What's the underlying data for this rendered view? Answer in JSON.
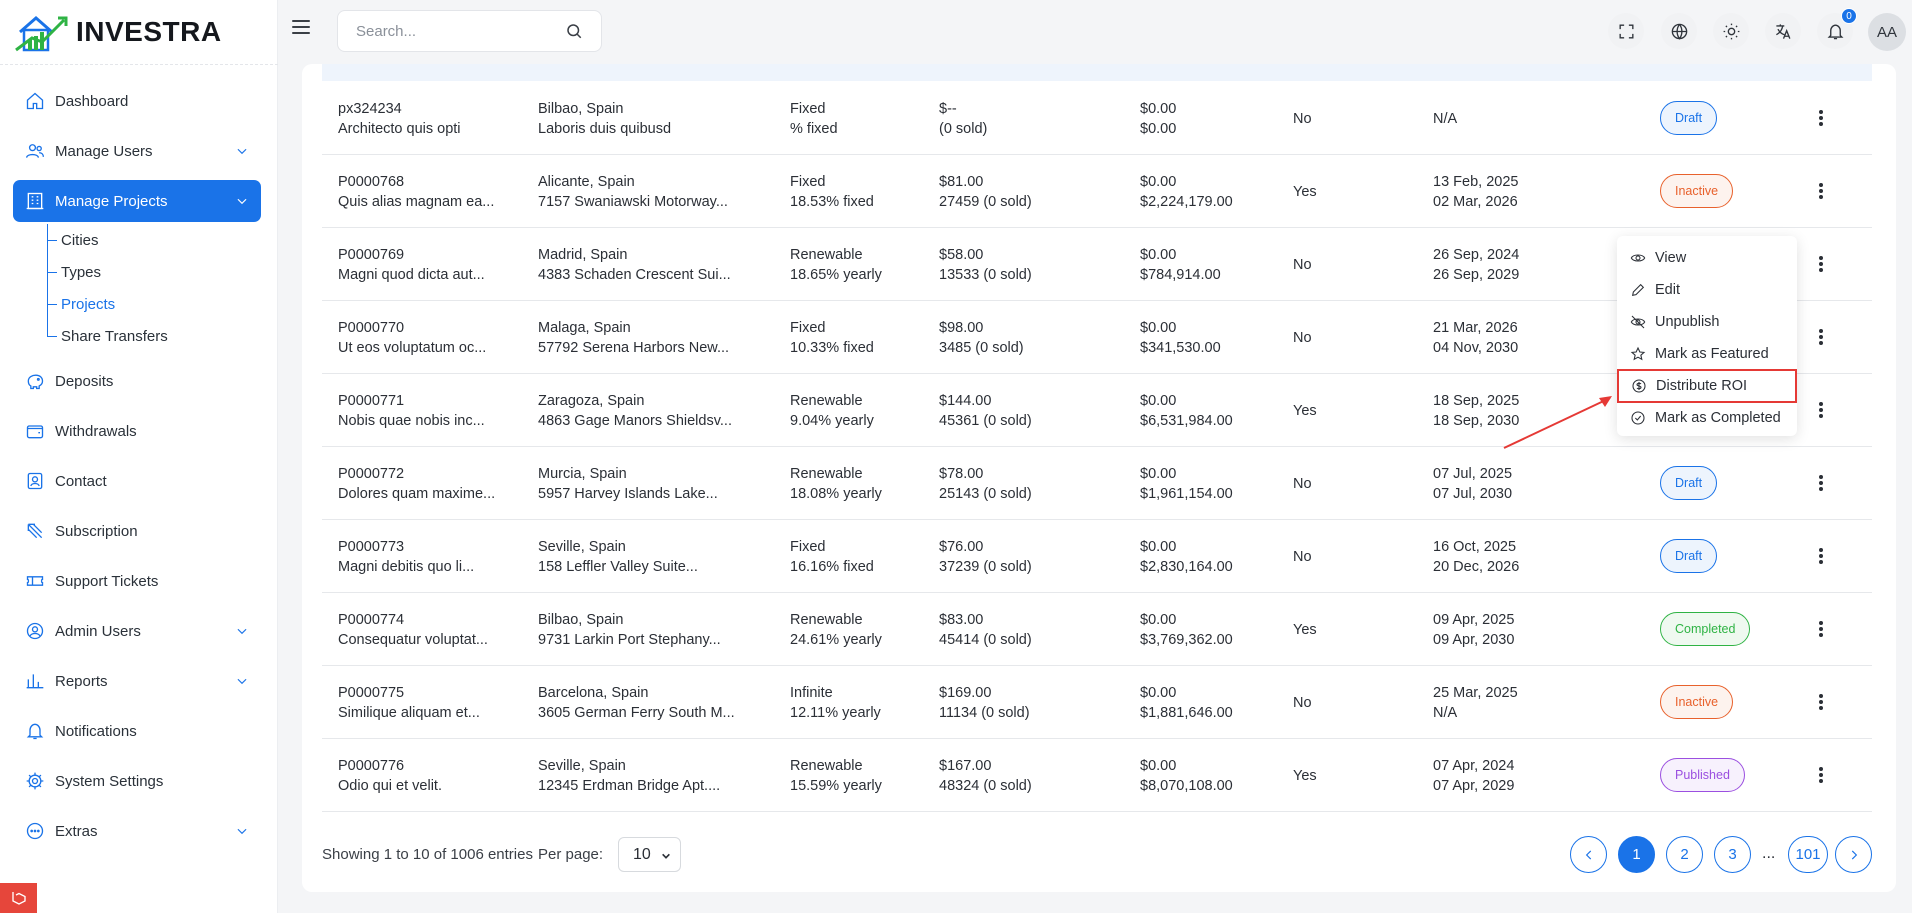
{
  "brand": {
    "name": "INVESTRA"
  },
  "header": {
    "search_placeholder": "Search...",
    "notification_count": "0",
    "avatar_initials": "AA"
  },
  "sidebar": {
    "items": [
      {
        "label": "Dashboard",
        "icon": "home-icon"
      },
      {
        "label": "Manage Users",
        "icon": "users-icon",
        "expandable": true
      },
      {
        "label": "Manage Projects",
        "icon": "building-icon",
        "expandable": true,
        "active": true
      },
      {
        "label": "Deposits",
        "icon": "piggy-bank-icon"
      },
      {
        "label": "Withdrawals",
        "icon": "wallet-icon"
      },
      {
        "label": "Contact",
        "icon": "contact-icon"
      },
      {
        "label": "Subscription",
        "icon": "subscription-icon"
      },
      {
        "label": "Support Tickets",
        "icon": "ticket-icon"
      },
      {
        "label": "Admin Users",
        "icon": "admin-icon",
        "expandable": true
      },
      {
        "label": "Reports",
        "icon": "chart-icon",
        "expandable": true
      },
      {
        "label": "Notifications",
        "icon": "bell-icon"
      },
      {
        "label": "System Settings",
        "icon": "gear-icon"
      },
      {
        "label": "Extras",
        "icon": "extras-icon",
        "expandable": true
      }
    ],
    "subitems": [
      {
        "label": "Cities"
      },
      {
        "label": "Types"
      },
      {
        "label": "Projects",
        "active": true
      },
      {
        "label": "Share Transfers"
      }
    ]
  },
  "rows": [
    {
      "id": "px324234",
      "name": "Architecto quis opti",
      "city": "Bilbao, Spain",
      "address": "Laboris duis quibusd",
      "type": "Fixed",
      "rate": "% fixed",
      "price": "$--",
      "shares": "(0 sold)",
      "invested": "$0.00",
      "target": "$0.00",
      "featured": "No",
      "date1": "N/A",
      "date2": "",
      "status": "Draft"
    },
    {
      "id": "P0000768",
      "name": "Quis alias magnam ea...",
      "city": "Alicante, Spain",
      "address": "7157 Swaniawski Motorway...",
      "type": "Fixed",
      "rate": "18.53% fixed",
      "price": "$81.00",
      "shares": "27459 (0 sold)",
      "invested": "$0.00",
      "target": "$2,224,179.00",
      "featured": "Yes",
      "date1": "13 Feb, 2025",
      "date2": "02 Mar, 2026",
      "status": "Inactive"
    },
    {
      "id": "P0000769",
      "name": "Magni quod dicta aut...",
      "city": "Madrid, Spain",
      "address": "4383 Schaden Crescent Sui...",
      "type": "Renewable",
      "rate": "18.65% yearly",
      "price": "$58.00",
      "shares": "13533 (0 sold)",
      "invested": "$0.00",
      "target": "$784,914.00",
      "featured": "No",
      "date1": "26 Sep, 2024",
      "date2": "26 Sep, 2029",
      "status": ""
    },
    {
      "id": "P0000770",
      "name": "Ut eos voluptatum oc...",
      "city": "Malaga, Spain",
      "address": "57792 Serena Harbors New...",
      "type": "Fixed",
      "rate": "10.33% fixed",
      "price": "$98.00",
      "shares": "3485 (0 sold)",
      "invested": "$0.00",
      "target": "$341,530.00",
      "featured": "No",
      "date1": "21 Mar, 2026",
      "date2": "04 Nov, 2030",
      "status": ""
    },
    {
      "id": "P0000771",
      "name": "Nobis quae nobis inc...",
      "city": "Zaragoza, Spain",
      "address": "4863 Gage Manors Shieldsv...",
      "type": "Renewable",
      "rate": "9.04% yearly",
      "price": "$144.00",
      "shares": "45361 (0 sold)",
      "invested": "$0.00",
      "target": "$6,531,984.00",
      "featured": "Yes",
      "date1": "18 Sep, 2025",
      "date2": "18 Sep, 2030",
      "status": ""
    },
    {
      "id": "P0000772",
      "name": "Dolores quam maxime...",
      "city": "Murcia, Spain",
      "address": "5957 Harvey Islands Lake...",
      "type": "Renewable",
      "rate": "18.08% yearly",
      "price": "$78.00",
      "shares": "25143 (0 sold)",
      "invested": "$0.00",
      "target": "$1,961,154.00",
      "featured": "No",
      "date1": "07 Jul, 2025",
      "date2": "07 Jul, 2030",
      "status": "Draft"
    },
    {
      "id": "P0000773",
      "name": "Magni debitis quo li...",
      "city": "Seville, Spain",
      "address": "158 Leffler Valley Suite...",
      "type": "Fixed",
      "rate": "16.16% fixed",
      "price": "$76.00",
      "shares": "37239 (0 sold)",
      "invested": "$0.00",
      "target": "$2,830,164.00",
      "featured": "No",
      "date1": "16 Oct, 2025",
      "date2": "20 Dec, 2026",
      "status": "Draft"
    },
    {
      "id": "P0000774",
      "name": "Consequatur voluptat...",
      "city": "Bilbao, Spain",
      "address": "9731 Larkin Port Stephany...",
      "type": "Renewable",
      "rate": "24.61% yearly",
      "price": "$83.00",
      "shares": "45414 (0 sold)",
      "invested": "$0.00",
      "target": "$3,769,362.00",
      "featured": "Yes",
      "date1": "09 Apr, 2025",
      "date2": "09 Apr, 2030",
      "status": "Completed"
    },
    {
      "id": "P0000775",
      "name": "Similique aliquam et...",
      "city": "Barcelona, Spain",
      "address": "3605 German Ferry South M...",
      "type": "Infinite",
      "rate": "12.11% yearly",
      "price": "$169.00",
      "shares": "11134 (0 sold)",
      "invested": "$0.00",
      "target": "$1,881,646.00",
      "featured": "No",
      "date1": "25 Mar, 2025",
      "date2": "N/A",
      "status": "Inactive"
    },
    {
      "id": "P0000776",
      "name": "Odio qui et velit.",
      "city": "Seville, Spain",
      "address": "12345 Erdman Bridge Apt....",
      "type": "Renewable",
      "rate": "15.59% yearly",
      "price": "$167.00",
      "shares": "48324 (0 sold)",
      "invested": "$0.00",
      "target": "$8,070,108.00",
      "featured": "Yes",
      "date1": "07 Apr, 2024",
      "date2": "07 Apr, 2029",
      "status": "Published"
    }
  ],
  "status_colors": {
    "Draft": "#1a73e8",
    "Inactive": "#e8612c",
    "Completed": "#2fb344",
    "Published": "#9b4fe0"
  },
  "dropdown": {
    "items": [
      {
        "label": "View",
        "icon": "eye-icon"
      },
      {
        "label": "Edit",
        "icon": "pencil-icon"
      },
      {
        "label": "Unpublish",
        "icon": "eye-off-icon"
      },
      {
        "label": "Mark as Featured",
        "icon": "star-icon"
      },
      {
        "label": "Distribute ROI",
        "icon": "dollar-circle-icon",
        "highlighted": true
      },
      {
        "label": "Mark as Completed",
        "icon": "check-circle-icon"
      }
    ]
  },
  "footer": {
    "showing_text": "Showing 1 to 10 of 1006 entries",
    "per_page_label": "Per page:",
    "per_page_value": "10",
    "pages": [
      "1",
      "2",
      "3"
    ],
    "ellipsis": "...",
    "last_page": "101",
    "current_page": "1"
  }
}
